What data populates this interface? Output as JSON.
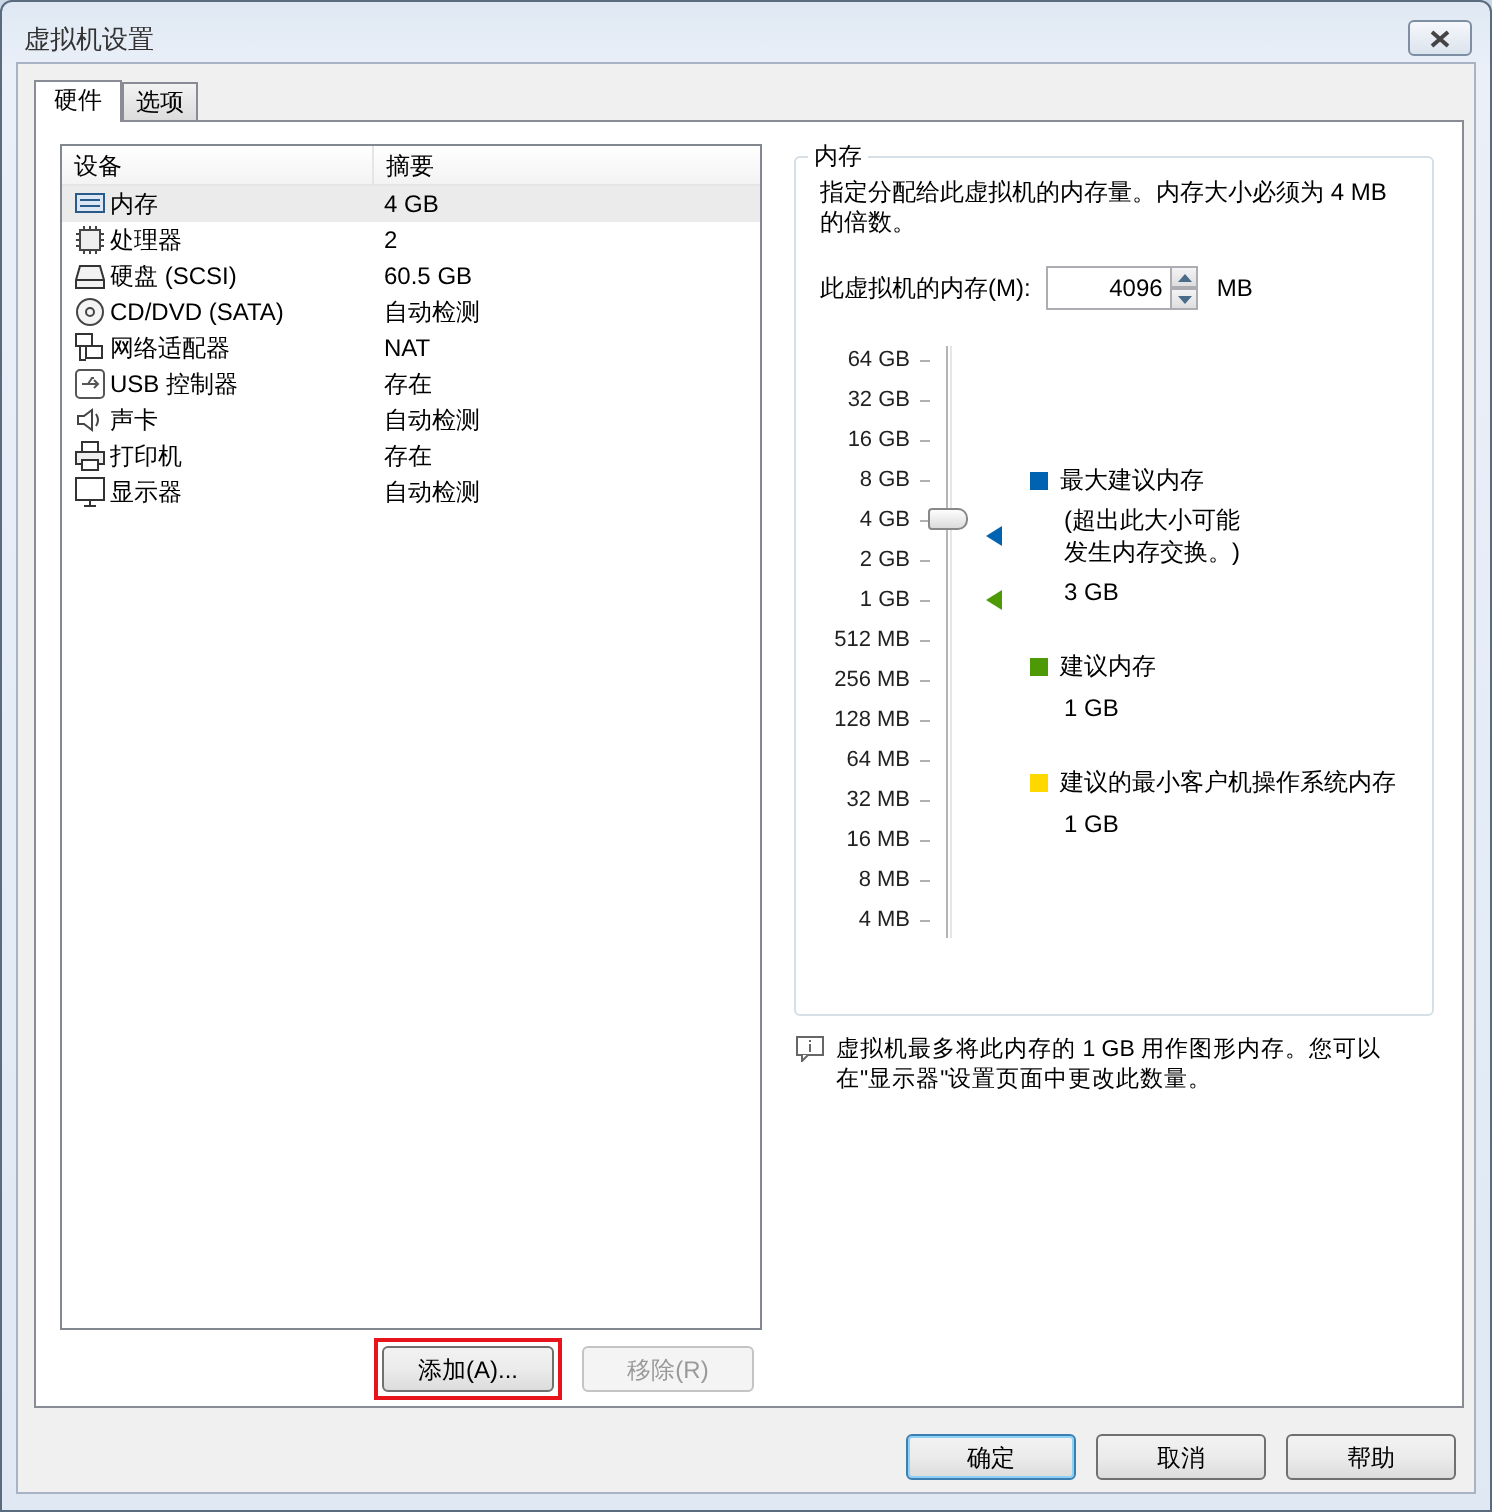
{
  "window": {
    "title": "虚拟机设置"
  },
  "tabs": [
    {
      "label": "硬件",
      "selected": true
    },
    {
      "label": "选项",
      "selected": false
    }
  ],
  "device_table": {
    "columns": [
      "设备",
      "摘要"
    ],
    "rows": [
      {
        "kind": "memory",
        "device": "内存",
        "summary": "4 GB",
        "selected": true
      },
      {
        "kind": "cpu",
        "device": "处理器",
        "summary": "2",
        "selected": false
      },
      {
        "kind": "disk",
        "device": "硬盘 (SCSI)",
        "summary": "60.5 GB",
        "selected": false
      },
      {
        "kind": "cd",
        "device": "CD/DVD (SATA)",
        "summary": "自动检测",
        "selected": false
      },
      {
        "kind": "network",
        "device": "网络适配器",
        "summary": "NAT",
        "selected": false
      },
      {
        "kind": "usb",
        "device": "USB 控制器",
        "summary": "存在",
        "selected": false
      },
      {
        "kind": "sound",
        "device": "声卡",
        "summary": "自动检测",
        "selected": false
      },
      {
        "kind": "printer",
        "device": "打印机",
        "summary": "存在",
        "selected": false
      },
      {
        "kind": "display",
        "device": "显示器",
        "summary": "自动检测",
        "selected": false
      }
    ]
  },
  "list_buttons": [
    {
      "label": "添加(A)...",
      "disabled": false,
      "highlighted": true
    },
    {
      "label": "移除(R)",
      "disabled": true,
      "highlighted": false
    }
  ],
  "memory_group": {
    "title": "内存",
    "description": "指定分配给此虚拟机的内存量。内存大小必须为 4 MB 的倍数。",
    "field_label": "此虚拟机的内存(M):",
    "value": "4096",
    "unit": "MB",
    "slider": {
      "labels": [
        "64 GB",
        "32 GB",
        "16 GB",
        "8 GB",
        "4 GB",
        "2 GB",
        "1 GB",
        "512 MB",
        "256 MB",
        "128 MB",
        "64 MB",
        "32 MB",
        "16 MB",
        "8 MB",
        "4 MB"
      ],
      "level": 0.714
    },
    "legend": [
      {
        "title": "最大建议内存",
        "note_lines": [
          "(超出此大小可能",
          "发生内存交换。)"
        ],
        "value": "3 GB",
        "color": "#0063b1"
      },
      {
        "title": "建议内存",
        "value": "1 GB",
        "color": "#4e9a06"
      },
      {
        "title": "建议的最小客户机操作系统内存",
        "value": "1 GB",
        "color": "#ffd800"
      }
    ]
  },
  "info": "虚拟机最多将此内存的 1 GB 用作图形内存。您可以在\"显示器\"设置页面中更改此数量。",
  "dialog_buttons": [
    {
      "label": "确定",
      "default": true
    },
    {
      "label": "取消",
      "default": false
    },
    {
      "label": "帮助",
      "default": false
    }
  ]
}
